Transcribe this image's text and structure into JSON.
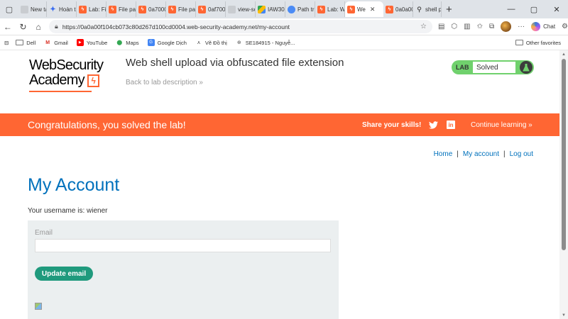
{
  "browser": {
    "tabs": [
      {
        "title": "New ta",
        "icon": "blank-page-icon",
        "active": false
      },
      {
        "title": "Hoàn tl",
        "icon": "gemini-star-icon",
        "active": false
      },
      {
        "title": "Lab: Fil",
        "icon": "portswigger-icon",
        "active": false
      },
      {
        "title": "File pat",
        "icon": "portswigger-icon",
        "active": false
      },
      {
        "title": "0a7000",
        "icon": "portswigger-icon",
        "active": false
      },
      {
        "title": "File pat",
        "icon": "portswigger-icon",
        "active": false
      },
      {
        "title": "0af700",
        "icon": "portswigger-icon",
        "active": false
      },
      {
        "title": "view-so",
        "icon": "blank-page-icon",
        "active": false
      },
      {
        "title": "IAW30",
        "icon": "google-drive-icon",
        "active": false
      },
      {
        "title": "Path tra",
        "icon": "globe-icon",
        "active": false
      },
      {
        "title": "Lab: We",
        "icon": "portswigger-icon",
        "active": false
      },
      {
        "title": "We",
        "icon": "portswigger-icon",
        "active": true
      },
      {
        "title": "0a0a00",
        "icon": "portswigger-icon",
        "active": false
      },
      {
        "title": "shell p",
        "icon": "search-icon",
        "active": false
      }
    ],
    "url": "https://0a0a00f104cb073c80d267d100cd0004.web-security-academy.net/my-account",
    "chat_label": "Chat",
    "bookmarks": [
      {
        "label": "Dell",
        "icon": "folder-icon"
      },
      {
        "label": "Gmail",
        "icon": "gmail-icon"
      },
      {
        "label": "YouTube",
        "icon": "youtube-icon"
      },
      {
        "label": "Maps",
        "icon": "maps-icon"
      },
      {
        "label": "Google Dịch",
        "icon": "translate-icon"
      },
      {
        "label": "Vẽ Đồ thị",
        "icon": "graph-icon"
      },
      {
        "label": "SE184915 - Nguyễ...",
        "icon": "globe-icon"
      }
    ],
    "other_favorites": "Other favorites"
  },
  "header": {
    "logo_line1": "WebSecurity",
    "logo_line2": "Academy",
    "lab_title": "Web shell upload via obfuscated file extension",
    "back_link": "Back to lab description",
    "lab_label": "LAB",
    "lab_status": "Solved"
  },
  "banner": {
    "message": "Congratulations, you solved the lab!",
    "share_label": "Share your skills!",
    "linkedin_label": "in",
    "continue_label": "Continue learning"
  },
  "nav": {
    "home": "Home",
    "my_account": "My account",
    "logout": "Log out",
    "separator": "|"
  },
  "account": {
    "heading": "My Account",
    "username_text": "Your username is: wiener",
    "email_label": "Email",
    "email_value": "",
    "update_button": "Update email"
  },
  "colors": {
    "brand_orange": "#ff6633",
    "link_blue": "#0071bc",
    "solved_green": "#70d16d",
    "button_teal": "#1f9a7d"
  }
}
